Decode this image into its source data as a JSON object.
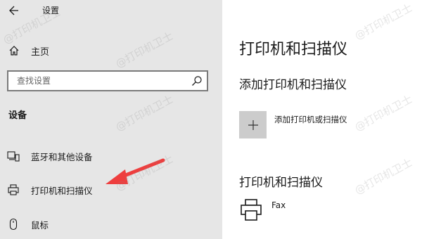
{
  "window": {
    "title": "设置"
  },
  "sidebar": {
    "home_label": "主页",
    "search_placeholder": "查找设置",
    "section_title": "设备",
    "items": [
      {
        "label": "蓝牙和其他设备",
        "icon": "bluetooth-devices-icon"
      },
      {
        "label": "打印机和扫描仪",
        "icon": "printer-icon"
      },
      {
        "label": "鼠标",
        "icon": "mouse-icon"
      }
    ]
  },
  "main": {
    "title": "打印机和扫描仪",
    "add_section_title": "添加打印机和扫描仪",
    "add_button_label": "添加打印机或扫描仪",
    "printers_section_title": "打印机和扫描仪",
    "printers": [
      {
        "name": "Fax",
        "icon": "printer-icon"
      }
    ]
  },
  "watermark": "@打印机卫士",
  "colors": {
    "sidebar_bg": "#e6e6e6",
    "main_bg": "#ffffff",
    "arrow": "#ee3e3e",
    "add_tile_bg": "#cccccc"
  }
}
